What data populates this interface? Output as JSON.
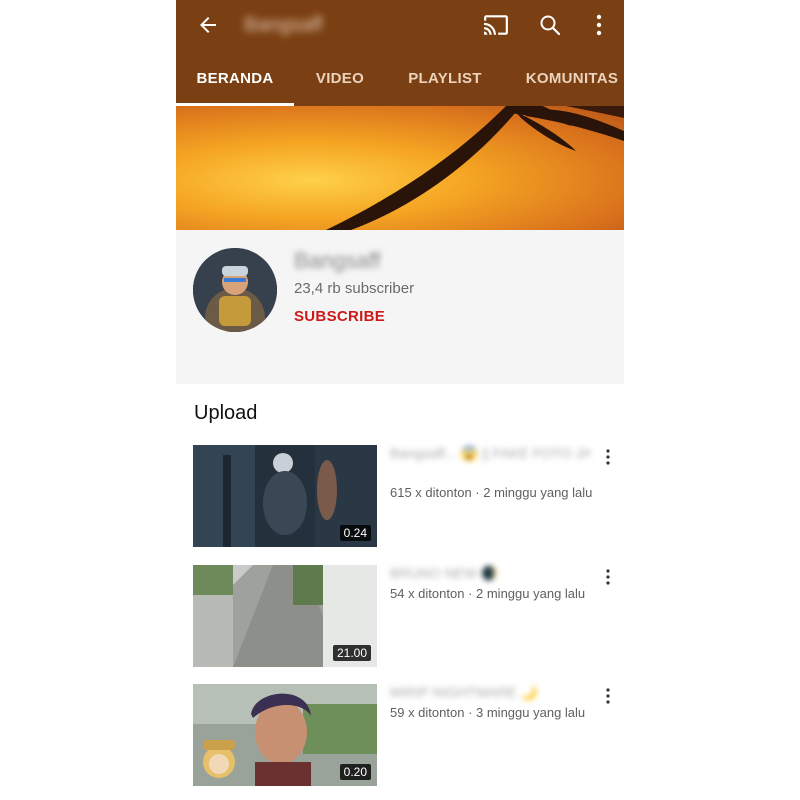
{
  "header": {
    "back_icon": "arrow-back-icon",
    "channel_title": "Bangsaff",
    "cast_icon": "cast-icon",
    "search_icon": "search-icon",
    "more_icon": "more-vert-icon",
    "bar_color": "#7a3f12"
  },
  "tabs": [
    {
      "label": "BERANDA",
      "active": true
    },
    {
      "label": "VIDEO"
    },
    {
      "label": "PLAYLIST"
    },
    {
      "label": "KOMUNITAS"
    }
  ],
  "channel": {
    "name": "Bangsaff",
    "subscribers": "23,4 rb subscriber",
    "subscribe_label": "SUBSCRIBE",
    "subscribe_color": "#cc1a1a"
  },
  "section": {
    "title": "Upload"
  },
  "videos": [
    {
      "title": "Bangsaff... 😱 || FAKE FOTO JASON ||",
      "duration": "0.24",
      "views": "615 x ditonton",
      "age": "2 minggu yang lalu"
    },
    {
      "title": "BRUNO NEW 🌒",
      "duration": "21.00",
      "views": "54 x ditonton",
      "age": "2 minggu yang lalu"
    },
    {
      "title": "MIRIP NIGHTMARE 🌙",
      "duration": "0.20",
      "views": "59 x ditonton",
      "age": "3 minggu yang lalu"
    }
  ]
}
